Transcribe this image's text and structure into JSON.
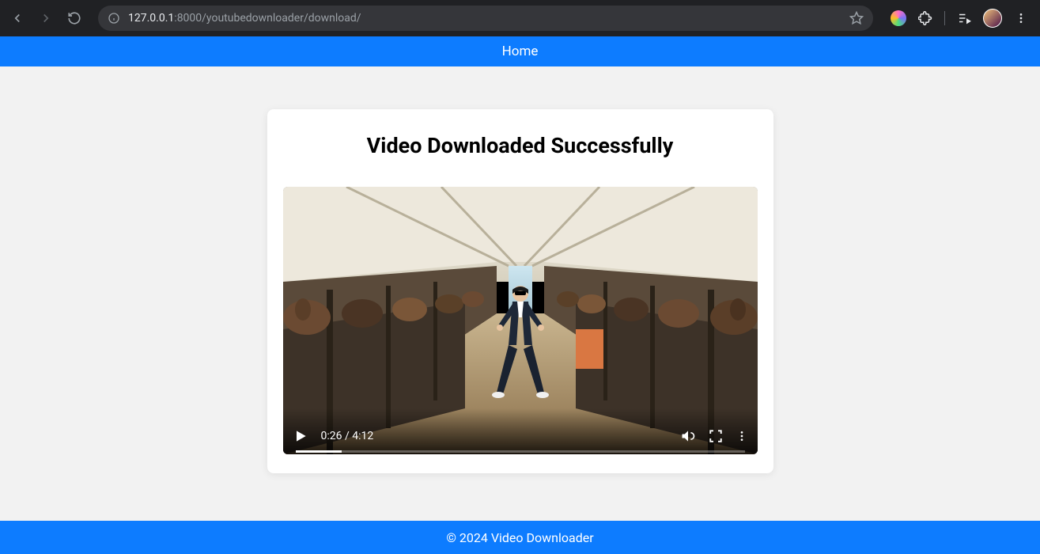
{
  "browser": {
    "url_bold": "127.0.0.1",
    "url_rest": ":8000/youtubedownloader/download/"
  },
  "nav": {
    "home": "Home"
  },
  "page": {
    "heading": "Video Downloaded Successfully"
  },
  "video": {
    "current_time": "0:26",
    "separator": " / ",
    "duration": "4:12",
    "progress_percent": 10.3
  },
  "footer": {
    "text": "© 2024 Video Downloader"
  }
}
